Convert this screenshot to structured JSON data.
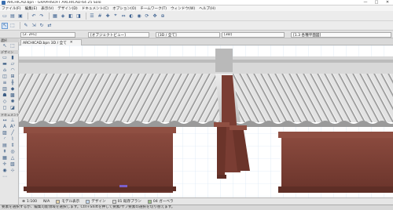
{
  "window": {
    "title": "ARCHICAD.bpn - GRAPHISOFT ARCHICAD-64 25 Solo",
    "minimize": "—",
    "maximize": "□",
    "close": "✕"
  },
  "menu": [
    "ファイル(F)",
    "編集(E)",
    "表示(V)",
    "デザイン(D)",
    "ドキュメント(C)",
    "オプション(O)",
    "チームワーク(T)",
    "ウィンドウ(W)",
    "ヘルプ(H)"
  ],
  "infobox": {
    "floor": "[2. 2FL]",
    "view": "[オブジェクトビュー]",
    "layout": "[3D / 全て]",
    "extra": "[3D]",
    "detail": "[1.3 各種平面図]"
  },
  "doc_tab": {
    "label": "ARCHICAD.bpn 3D / 全て",
    "close": "✕"
  },
  "toolbox": {
    "sections": [
      "選択",
      "デザイン",
      "ドキュメント"
    ]
  },
  "navbar": {
    "scale": "1:100",
    "zoom": "N/A",
    "layer_combo": "モデル表示",
    "model_view": "デザイン",
    "renovation": "01 既存プラン",
    "override": "04 ガーベラ"
  },
  "statusbar": {
    "text": "要素を選択するか、編集可能領域を選択します。Ctrl+Shiftを押して要素/サブ要素の選択を切り替えます。"
  }
}
